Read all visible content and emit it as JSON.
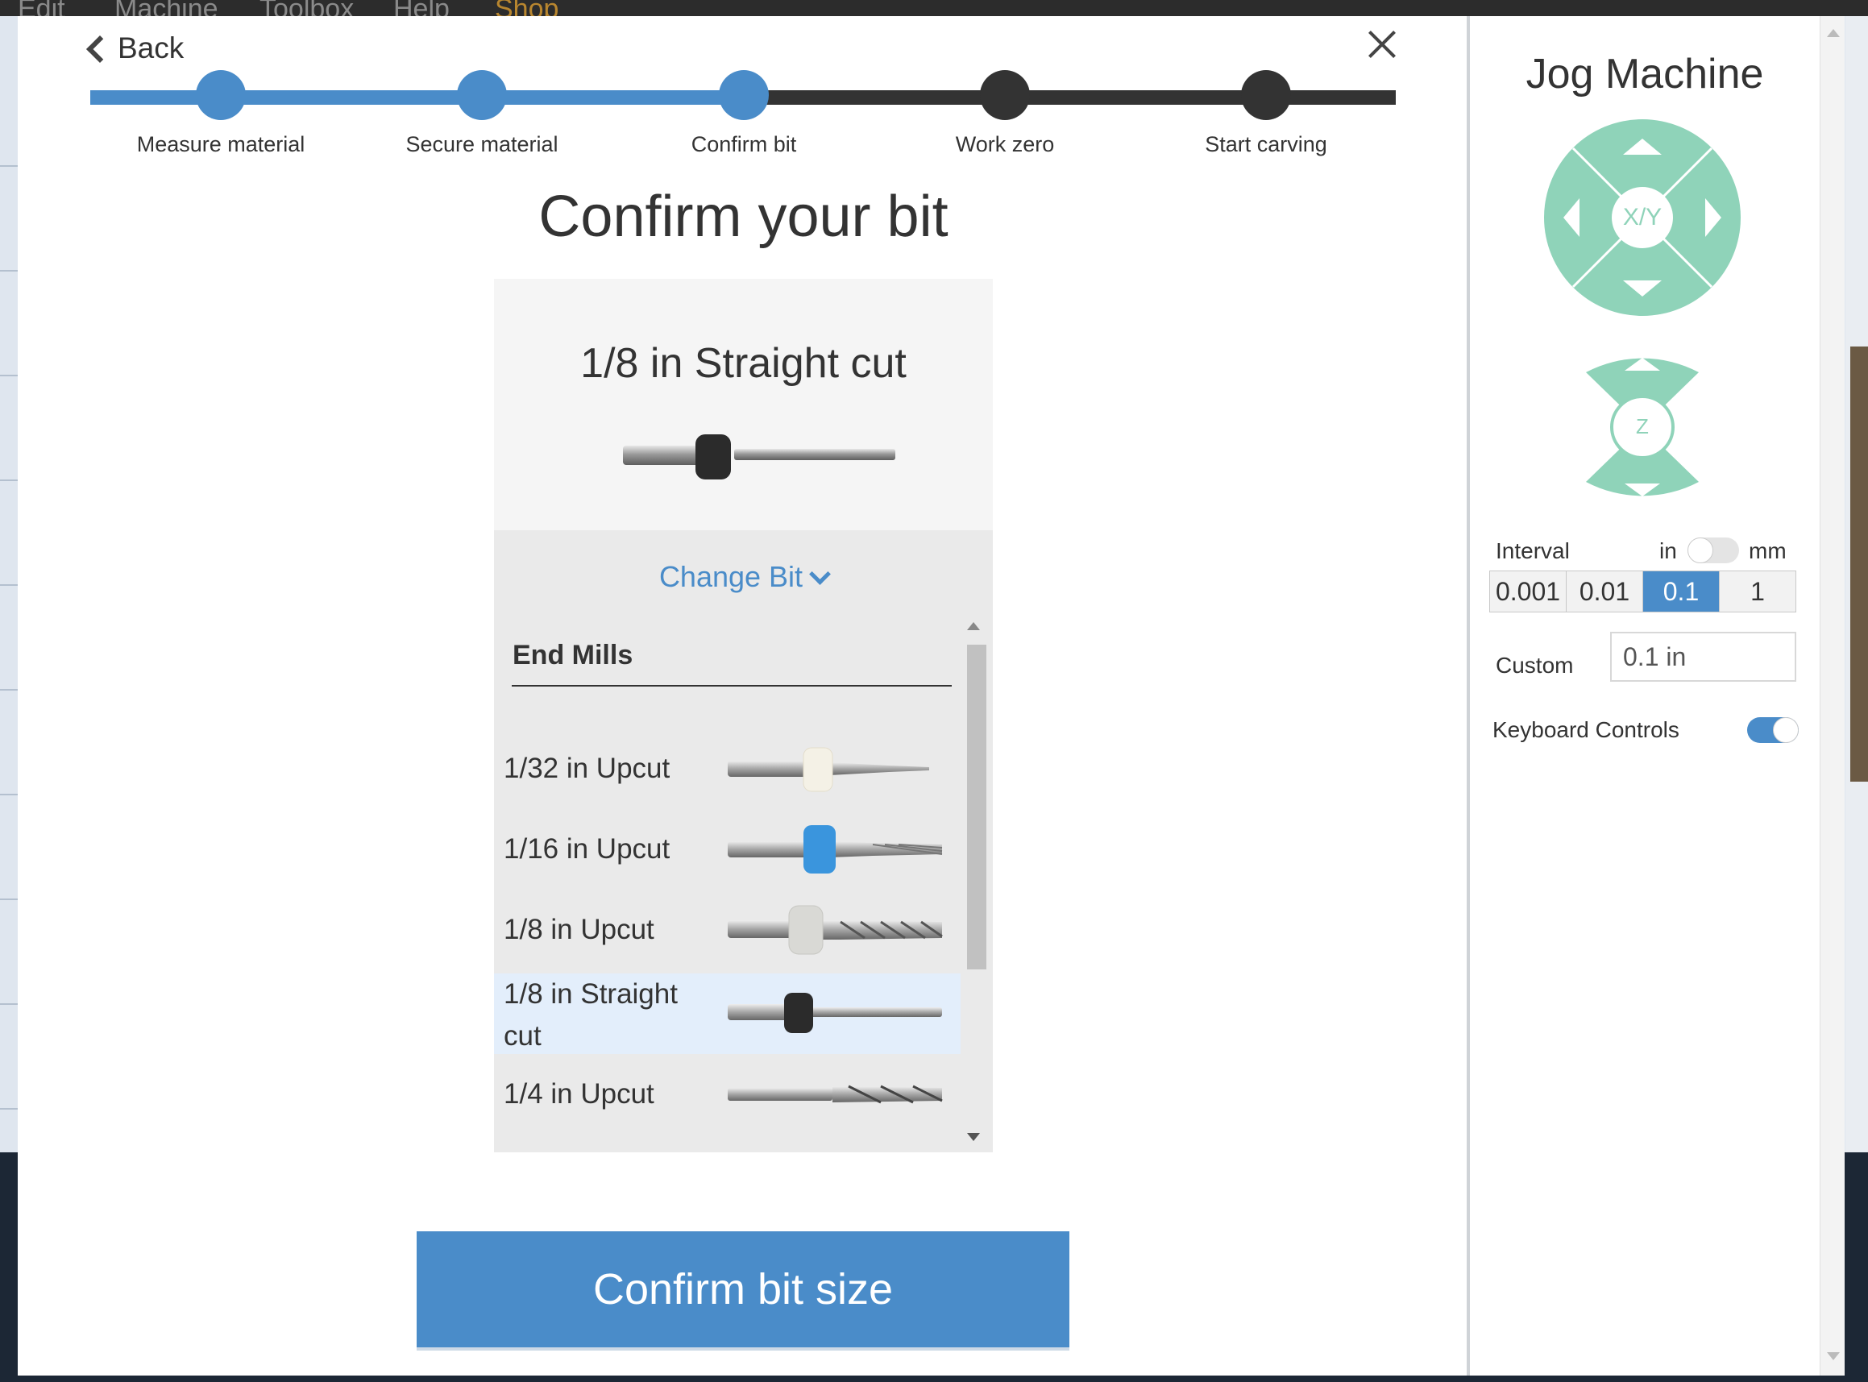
{
  "menubar": {
    "items": [
      "Edit",
      "Machine",
      "Toolbox",
      "Help",
      "Shop"
    ]
  },
  "modal": {
    "back_label": "Back",
    "steps": [
      {
        "label": "Measure material",
        "state": "complete"
      },
      {
        "label": "Secure material",
        "state": "complete"
      },
      {
        "label": "Confirm bit",
        "state": "current"
      },
      {
        "label": "Work zero",
        "state": "pending"
      },
      {
        "label": "Start carving",
        "state": "pending"
      }
    ],
    "title": "Confirm your bit",
    "selected_bit": {
      "name": "1/8 in Straight cut",
      "collar_color": "#2b2b2b"
    },
    "change_bit_label": "Change Bit",
    "bit_list": {
      "category": "End Mills",
      "items": [
        {
          "name": "1/32 in Upcut",
          "collar_color": "#f4f1e6",
          "selected": false
        },
        {
          "name": "1/16 in Upcut",
          "collar_color": "#3a95dd",
          "selected": false
        },
        {
          "name": "1/8 in Upcut",
          "collar_color": "#d9d9d5",
          "selected": false
        },
        {
          "name": "1/8 in Straight cut",
          "collar_color": "#2b2b2b",
          "selected": true
        },
        {
          "name": "1/4 in Upcut",
          "collar_color": "",
          "selected": false
        }
      ]
    },
    "confirm_label": "Confirm bit size"
  },
  "jog": {
    "title": "Jog Machine",
    "xy_label": "X/Y",
    "z_label": "Z",
    "interval_label": "Interval",
    "unit_left": "in",
    "unit_right": "mm",
    "intervals": [
      "0.001",
      "0.01",
      "0.1",
      "1"
    ],
    "active_interval": "0.1",
    "custom_label": "Custom",
    "custom_value": "0.1 in",
    "keyboard_label": "Keyboard Controls",
    "keyboard_enabled": true,
    "pad_color": "#8fd3b9"
  },
  "colors": {
    "accent": "#4a8cc9",
    "dark": "#333333",
    "jog": "#8fd3b9"
  }
}
